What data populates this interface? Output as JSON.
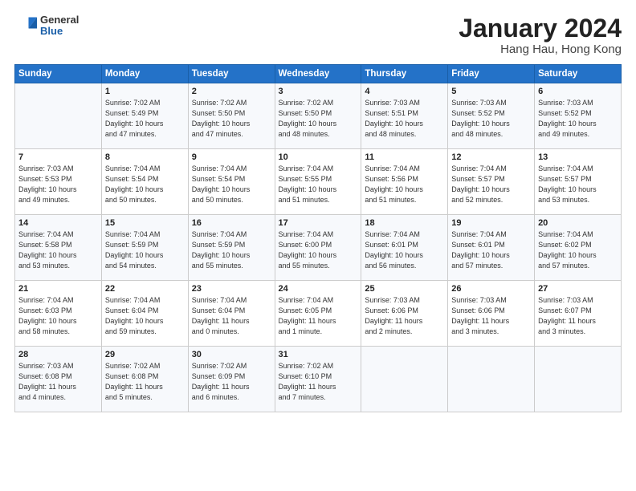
{
  "header": {
    "logo_general": "General",
    "logo_blue": "Blue",
    "title": "January 2024",
    "location": "Hang Hau, Hong Kong"
  },
  "days_of_week": [
    "Sunday",
    "Monday",
    "Tuesday",
    "Wednesday",
    "Thursday",
    "Friday",
    "Saturday"
  ],
  "weeks": [
    [
      {
        "day": "",
        "info": ""
      },
      {
        "day": "1",
        "info": "Sunrise: 7:02 AM\nSunset: 5:49 PM\nDaylight: 10 hours\nand 47 minutes."
      },
      {
        "day": "2",
        "info": "Sunrise: 7:02 AM\nSunset: 5:50 PM\nDaylight: 10 hours\nand 47 minutes."
      },
      {
        "day": "3",
        "info": "Sunrise: 7:02 AM\nSunset: 5:50 PM\nDaylight: 10 hours\nand 48 minutes."
      },
      {
        "day": "4",
        "info": "Sunrise: 7:03 AM\nSunset: 5:51 PM\nDaylight: 10 hours\nand 48 minutes."
      },
      {
        "day": "5",
        "info": "Sunrise: 7:03 AM\nSunset: 5:52 PM\nDaylight: 10 hours\nand 48 minutes."
      },
      {
        "day": "6",
        "info": "Sunrise: 7:03 AM\nSunset: 5:52 PM\nDaylight: 10 hours\nand 49 minutes."
      }
    ],
    [
      {
        "day": "7",
        "info": "Sunrise: 7:03 AM\nSunset: 5:53 PM\nDaylight: 10 hours\nand 49 minutes."
      },
      {
        "day": "8",
        "info": "Sunrise: 7:04 AM\nSunset: 5:54 PM\nDaylight: 10 hours\nand 50 minutes."
      },
      {
        "day": "9",
        "info": "Sunrise: 7:04 AM\nSunset: 5:54 PM\nDaylight: 10 hours\nand 50 minutes."
      },
      {
        "day": "10",
        "info": "Sunrise: 7:04 AM\nSunset: 5:55 PM\nDaylight: 10 hours\nand 51 minutes."
      },
      {
        "day": "11",
        "info": "Sunrise: 7:04 AM\nSunset: 5:56 PM\nDaylight: 10 hours\nand 51 minutes."
      },
      {
        "day": "12",
        "info": "Sunrise: 7:04 AM\nSunset: 5:57 PM\nDaylight: 10 hours\nand 52 minutes."
      },
      {
        "day": "13",
        "info": "Sunrise: 7:04 AM\nSunset: 5:57 PM\nDaylight: 10 hours\nand 53 minutes."
      }
    ],
    [
      {
        "day": "14",
        "info": "Sunrise: 7:04 AM\nSunset: 5:58 PM\nDaylight: 10 hours\nand 53 minutes."
      },
      {
        "day": "15",
        "info": "Sunrise: 7:04 AM\nSunset: 5:59 PM\nDaylight: 10 hours\nand 54 minutes."
      },
      {
        "day": "16",
        "info": "Sunrise: 7:04 AM\nSunset: 5:59 PM\nDaylight: 10 hours\nand 55 minutes."
      },
      {
        "day": "17",
        "info": "Sunrise: 7:04 AM\nSunset: 6:00 PM\nDaylight: 10 hours\nand 55 minutes."
      },
      {
        "day": "18",
        "info": "Sunrise: 7:04 AM\nSunset: 6:01 PM\nDaylight: 10 hours\nand 56 minutes."
      },
      {
        "day": "19",
        "info": "Sunrise: 7:04 AM\nSunset: 6:01 PM\nDaylight: 10 hours\nand 57 minutes."
      },
      {
        "day": "20",
        "info": "Sunrise: 7:04 AM\nSunset: 6:02 PM\nDaylight: 10 hours\nand 57 minutes."
      }
    ],
    [
      {
        "day": "21",
        "info": "Sunrise: 7:04 AM\nSunset: 6:03 PM\nDaylight: 10 hours\nand 58 minutes."
      },
      {
        "day": "22",
        "info": "Sunrise: 7:04 AM\nSunset: 6:04 PM\nDaylight: 10 hours\nand 59 minutes."
      },
      {
        "day": "23",
        "info": "Sunrise: 7:04 AM\nSunset: 6:04 PM\nDaylight: 11 hours\nand 0 minutes."
      },
      {
        "day": "24",
        "info": "Sunrise: 7:04 AM\nSunset: 6:05 PM\nDaylight: 11 hours\nand 1 minute."
      },
      {
        "day": "25",
        "info": "Sunrise: 7:03 AM\nSunset: 6:06 PM\nDaylight: 11 hours\nand 2 minutes."
      },
      {
        "day": "26",
        "info": "Sunrise: 7:03 AM\nSunset: 6:06 PM\nDaylight: 11 hours\nand 3 minutes."
      },
      {
        "day": "27",
        "info": "Sunrise: 7:03 AM\nSunset: 6:07 PM\nDaylight: 11 hours\nand 3 minutes."
      }
    ],
    [
      {
        "day": "28",
        "info": "Sunrise: 7:03 AM\nSunset: 6:08 PM\nDaylight: 11 hours\nand 4 minutes."
      },
      {
        "day": "29",
        "info": "Sunrise: 7:02 AM\nSunset: 6:08 PM\nDaylight: 11 hours\nand 5 minutes."
      },
      {
        "day": "30",
        "info": "Sunrise: 7:02 AM\nSunset: 6:09 PM\nDaylight: 11 hours\nand 6 minutes."
      },
      {
        "day": "31",
        "info": "Sunrise: 7:02 AM\nSunset: 6:10 PM\nDaylight: 11 hours\nand 7 minutes."
      },
      {
        "day": "",
        "info": ""
      },
      {
        "day": "",
        "info": ""
      },
      {
        "day": "",
        "info": ""
      }
    ]
  ]
}
